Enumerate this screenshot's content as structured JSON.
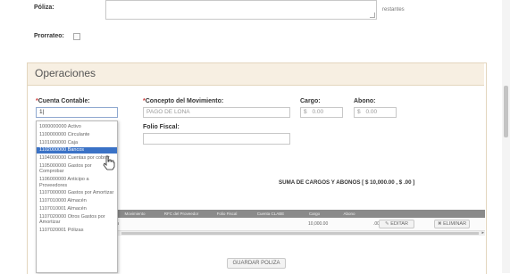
{
  "top": {
    "poliza_label": "Póliza:",
    "restantes_label": "restantes",
    "prorrateo_label": "Prorrateo:"
  },
  "operaciones": {
    "title": "Operaciones",
    "cuenta_label": "Cuenta Contable:",
    "cuenta_value": "1|",
    "concepto_label": "Concepto del Movimiento:",
    "concepto_value": "PAGO DE LONA",
    "cargo_label": "Cargo:",
    "cargo_prefix": "$",
    "cargo_value": "0.00",
    "abono_label": "Abono:",
    "abono_prefix": "$",
    "abono_value": "0.00",
    "folio_label": "Folio Fiscal:",
    "suma_text": "SUMA DE CARGOS Y ABONOS [ $  10,000.00  , $  .00  ]"
  },
  "dropdown": {
    "items": [
      {
        "text": "1000000000 Activo"
      },
      {
        "text": "1100000000 Circulante"
      },
      {
        "text": "1101000000 Caja"
      },
      {
        "text": "1102000000 Bancos",
        "selected": true
      },
      {
        "text": "1104000000 Cuentas por cobrar",
        "lines": 2
      },
      {
        "text": "1105000000 Gastos por Comprobar",
        "lines": 2
      },
      {
        "text": "1106000000 Anticipo a Proveedores",
        "lines": 2
      },
      {
        "text": "1107000000 Gastos por Amortizar",
        "lines": 2
      },
      {
        "text": "1107010000 Almacén"
      },
      {
        "text": "1107010001 Almacén"
      },
      {
        "text": "1107020000 Otros Gastos por Amortizar",
        "lines": 2
      },
      {
        "text": "1107020001 Pólizas"
      }
    ]
  },
  "table": {
    "headers": [
      "Movimiento",
      "RFC del Proveedor",
      "Folio Fiscal",
      "Cuenta CLABE",
      "Cargo",
      "Abono"
    ],
    "row": {
      "col1": "n",
      "cargo": "10,000.00",
      "abono": ".00",
      "edit_label": "EDITAR",
      "delete_label": "ELIMINAR"
    }
  },
  "footer": {
    "save_label": "GUARDAR POLIZA"
  }
}
